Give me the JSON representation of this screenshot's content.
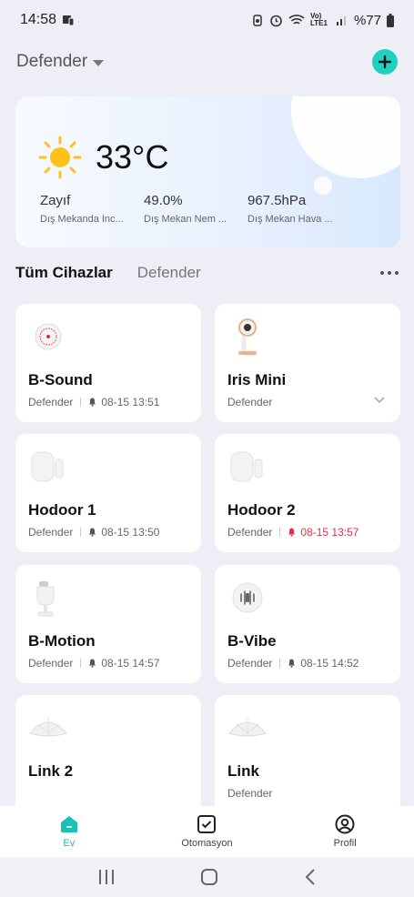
{
  "status_bar": {
    "time": "14:58",
    "battery": "%77",
    "network": "Vo) LTE1"
  },
  "header": {
    "home_name": "Defender"
  },
  "weather": {
    "temperature": "33°C",
    "stats": [
      {
        "value": "Zayıf",
        "label": "Dış Mekanda İnc..."
      },
      {
        "value": "49.0%",
        "label": "Dış Mekan Nem ..."
      },
      {
        "value": "967.5hPa",
        "label": "Dış Mekan Hava ..."
      }
    ]
  },
  "tabs": {
    "active": "Tüm Cihazlar",
    "other": "Defender"
  },
  "devices": [
    {
      "name": "B-Sound",
      "room": "Defender",
      "time": "08-15 13:51",
      "icon": "siren-icon",
      "alert": false
    },
    {
      "name": "Iris Mini",
      "room": "Defender",
      "time": "",
      "icon": "camera-icon",
      "alert": false
    },
    {
      "name": "Hodoor 1",
      "room": "Defender",
      "time": "08-15 13:50",
      "icon": "door-sensor-icon",
      "alert": false
    },
    {
      "name": "Hodoor 2",
      "room": "Defender",
      "time": "08-15 13:57",
      "icon": "door-sensor-icon",
      "alert": true
    },
    {
      "name": "B-Motion",
      "room": "Defender",
      "time": "08-15 14:57",
      "icon": "motion-sensor-icon",
      "alert": false
    },
    {
      "name": "B-Vibe",
      "room": "Defender",
      "time": "08-15 14:52",
      "icon": "vibration-sensor-icon",
      "alert": false
    },
    {
      "name": "Link 2",
      "room": "",
      "time": "",
      "icon": "hub-icon",
      "alert": false
    },
    {
      "name": "Link",
      "room": "Defender",
      "time": "",
      "icon": "hub-icon",
      "alert": false
    }
  ],
  "bottom_nav": [
    {
      "label": "Ev",
      "icon": "home-icon",
      "active": true
    },
    {
      "label": "Otomasyon",
      "icon": "automation-icon",
      "active": false
    },
    {
      "label": "Profil",
      "icon": "profile-icon",
      "active": false
    }
  ],
  "colors": {
    "accent": "#1fd1c2",
    "alert": "#d8344a",
    "background": "#eeeef6"
  }
}
